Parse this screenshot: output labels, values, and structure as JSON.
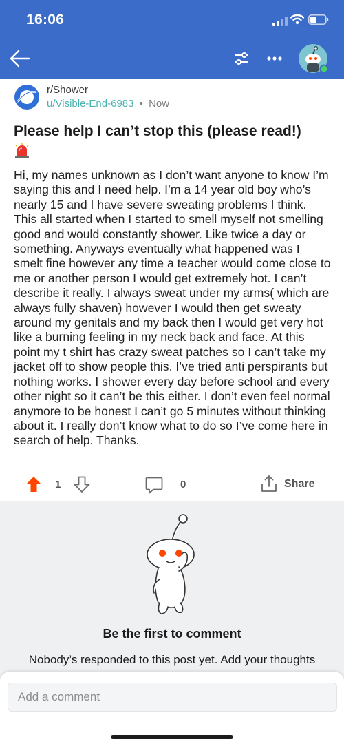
{
  "status_bar": {
    "time": "16:06"
  },
  "post": {
    "subreddit": "r/Shower",
    "author": "u/Visible-End-6983",
    "separator": "•",
    "time_ago": "Now",
    "title": "Please help I can’t stop this (please read!)",
    "body": "Hi, my names unknown as I don’t want anyone to know I’m saying this and I need help. I’m a 14 year old boy who’s nearly 15 and I have severe sweating problems I think. This all started when I started to smell myself not smelling good and would constantly shower. Like twice a day or something. Anyways eventually what happened was I smelt fine however any time a teacher would come close to me or another person I would get extremely hot. I can’t describe it really. I always sweat under my arms( which are always fully shaven) however I would then get sweaty around my genitals and my back then I would get very hot like a burning feeling in my neck back and face. At this point my t shirt has crazy sweat patches so I can’t take my jacket off to show people this. I’ve tried anti perspirants but nothing works. I shower every day before school and every other night so it can’t be this either. I don’t even feel normal anymore to be honest I can’t go 5 minutes without thinking about it. I really don’t know what to do so I’ve come here in search of help. Thanks."
  },
  "actions": {
    "vote_count": "1",
    "comment_count": "0",
    "share_label": "Share"
  },
  "empty_state": {
    "title": "Be the first to comment",
    "description": "Nobody’s responded to this post yet. Add your thoughts and get the conversation going."
  },
  "composer": {
    "placeholder": "Add a comment"
  },
  "icons": {
    "back": "arrow-left-icon",
    "filter": "sliders-icon",
    "more": "more-horizontal-icon",
    "title_emoji": "siren-emoji-icon",
    "upvote": "upvote-arrow-icon",
    "downvote": "downvote-arrow-icon",
    "comment": "comment-bubble-icon",
    "share": "share-icon"
  },
  "colors": {
    "header_blue": "#3c6cc9",
    "upvote_orange": "#ff4500",
    "author_teal": "#4ab3b0",
    "online_green": "#46d160"
  }
}
